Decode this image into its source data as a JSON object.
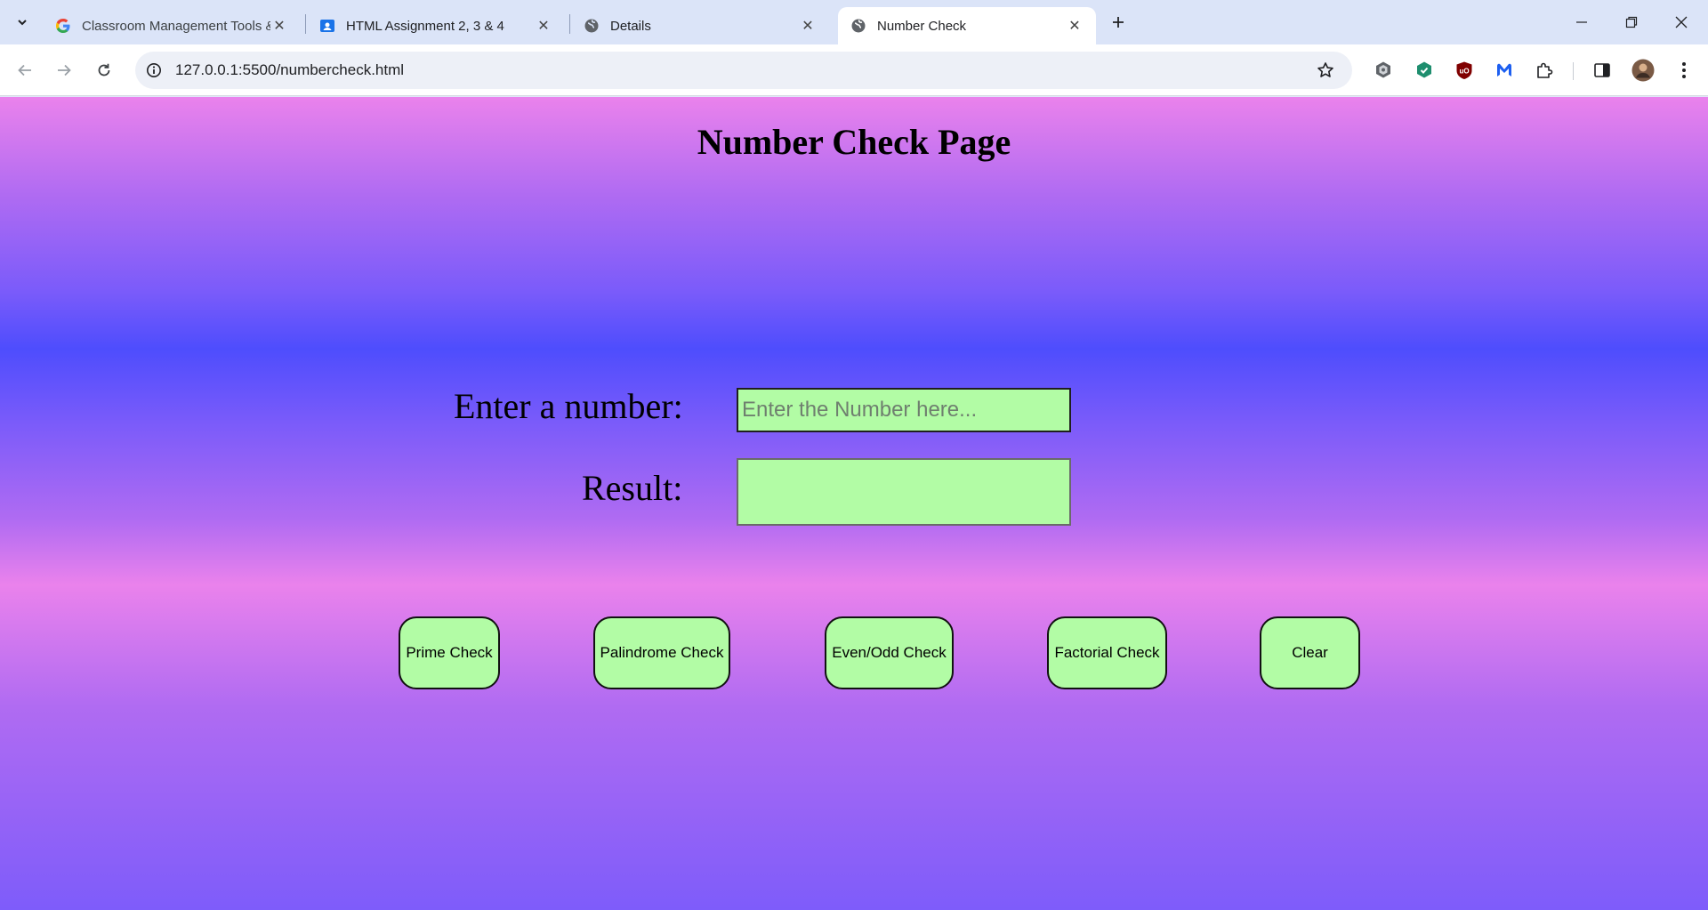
{
  "browser": {
    "tabs": [
      {
        "title": "Classroom Management Tools &",
        "favicon": "google-g-icon",
        "active": false
      },
      {
        "title": "HTML Assignment 2, 3 & 4",
        "favicon": "classroom-icon",
        "active": false
      },
      {
        "title": "Details",
        "favicon": "globe-icon",
        "active": false
      },
      {
        "title": "Number Check",
        "favicon": "globe-icon",
        "active": true
      }
    ],
    "url": "127.0.0.1:5500/numbercheck.html",
    "extensions": [
      "shield-icon",
      "green-shield-icon",
      "ublock-icon",
      "malwarebytes-icon",
      "puzzle-icon"
    ]
  },
  "page": {
    "title": "Number Check Page",
    "number_label": "Enter a number:",
    "number_placeholder": "Enter the Number here...",
    "number_value": "",
    "result_label": "Result:",
    "result_value": "",
    "buttons": {
      "prime": "Prime Check",
      "palindrome": "Palindrome Check",
      "evenodd": "Even/Odd Check",
      "factorial": "Factorial Check",
      "clear": "Clear"
    }
  },
  "colors": {
    "field_bg": "#b2fca5",
    "gradient_pink": "#ea82ec",
    "gradient_blue": "#4e4dfd"
  }
}
